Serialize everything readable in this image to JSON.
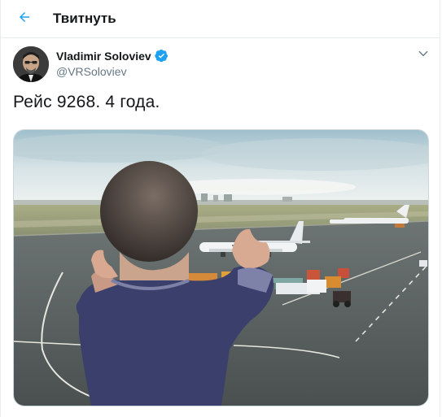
{
  "header": {
    "title": "Твитнуть",
    "back_icon": "arrow-left-icon",
    "accent_color": "#1da1f2"
  },
  "tweet": {
    "author": {
      "display_name": "Vladimir Soloviev",
      "handle": "@VRSoloviev",
      "verified": true,
      "verified_icon": "verified-badge-icon"
    },
    "menu_icon": "chevron-down-icon",
    "text": "Рейс 9268. 4 года.",
    "media": {
      "kind": "photo",
      "subject": "airport-apron-photo"
    }
  }
}
